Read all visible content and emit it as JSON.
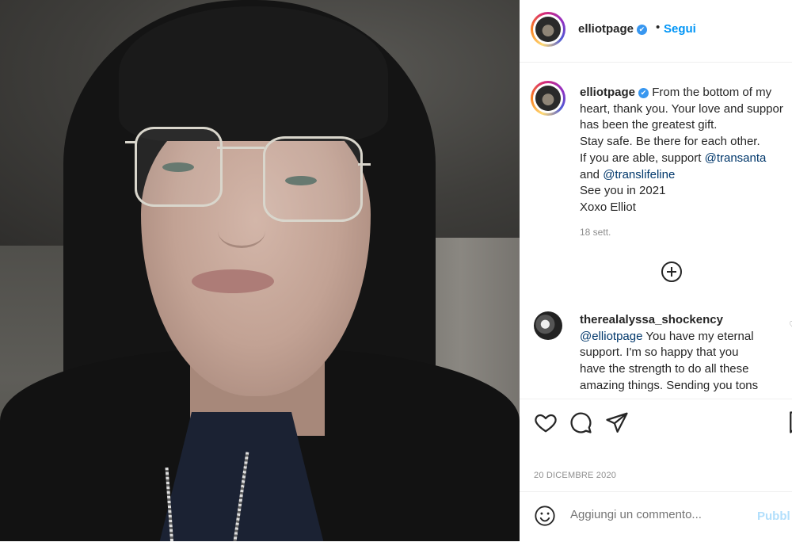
{
  "post": {
    "username": "elliotpage",
    "verified_mark": "✔",
    "separator": "•",
    "follow_label": "Segui"
  },
  "caption": {
    "username": "elliotpage",
    "line1": "From the bottom of my",
    "line2": "heart, thank you. Your love and suppor",
    "line3": "has been the greatest gift.",
    "line4": "Stay safe. Be there for each other.",
    "line5_prefix": "If you are able, support ",
    "line5_mention": "@transanta",
    "line6_prefix": "and ",
    "line6_mention": "@translifeline",
    "line7": "See you in 2021",
    "line8": "Xoxo Elliot",
    "time": "18 sett."
  },
  "comment": {
    "username": "therealalyssa_shockency",
    "mention": "@elliotpage",
    "line1_rest": " You have my eternal",
    "line2": "support. I'm so happy that you",
    "line3": "have the strength to do all these",
    "line4": "amazing things. Sending you tons"
  },
  "footer": {
    "date": "20 DICEMBRE 2020",
    "comment_placeholder": "Aggiungi un commento...",
    "publish_label": "Pubbl"
  },
  "icons": {
    "like": "heart-icon",
    "comment": "comment-bubble-icon",
    "share": "paper-plane-icon",
    "save": "bookmark-icon",
    "emoji": "smiley-icon",
    "load_more": "plus-circle-icon"
  },
  "colors": {
    "link": "#0095f6",
    "mention": "#00376b",
    "verified": "#3897f0",
    "muted": "#8e8e8e"
  }
}
